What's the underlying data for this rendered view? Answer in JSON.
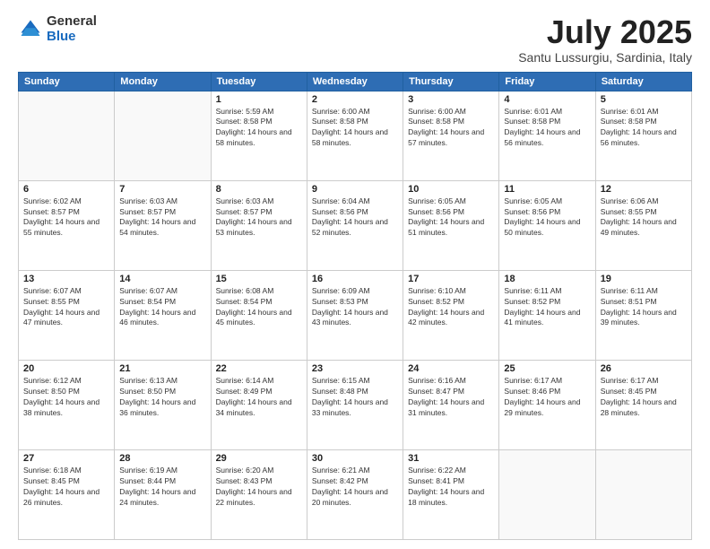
{
  "header": {
    "logo_general": "General",
    "logo_blue": "Blue",
    "title": "July 2025",
    "location": "Santu Lussurgiu, Sardinia, Italy"
  },
  "weekdays": [
    "Sunday",
    "Monday",
    "Tuesday",
    "Wednesday",
    "Thursday",
    "Friday",
    "Saturday"
  ],
  "weeks": [
    [
      {
        "day": "",
        "sunrise": "",
        "sunset": "",
        "daylight": ""
      },
      {
        "day": "",
        "sunrise": "",
        "sunset": "",
        "daylight": ""
      },
      {
        "day": "1",
        "sunrise": "Sunrise: 5:59 AM",
        "sunset": "Sunset: 8:58 PM",
        "daylight": "Daylight: 14 hours and 58 minutes."
      },
      {
        "day": "2",
        "sunrise": "Sunrise: 6:00 AM",
        "sunset": "Sunset: 8:58 PM",
        "daylight": "Daylight: 14 hours and 58 minutes."
      },
      {
        "day": "3",
        "sunrise": "Sunrise: 6:00 AM",
        "sunset": "Sunset: 8:58 PM",
        "daylight": "Daylight: 14 hours and 57 minutes."
      },
      {
        "day": "4",
        "sunrise": "Sunrise: 6:01 AM",
        "sunset": "Sunset: 8:58 PM",
        "daylight": "Daylight: 14 hours and 56 minutes."
      },
      {
        "day": "5",
        "sunrise": "Sunrise: 6:01 AM",
        "sunset": "Sunset: 8:58 PM",
        "daylight": "Daylight: 14 hours and 56 minutes."
      }
    ],
    [
      {
        "day": "6",
        "sunrise": "Sunrise: 6:02 AM",
        "sunset": "Sunset: 8:57 PM",
        "daylight": "Daylight: 14 hours and 55 minutes."
      },
      {
        "day": "7",
        "sunrise": "Sunrise: 6:03 AM",
        "sunset": "Sunset: 8:57 PM",
        "daylight": "Daylight: 14 hours and 54 minutes."
      },
      {
        "day": "8",
        "sunrise": "Sunrise: 6:03 AM",
        "sunset": "Sunset: 8:57 PM",
        "daylight": "Daylight: 14 hours and 53 minutes."
      },
      {
        "day": "9",
        "sunrise": "Sunrise: 6:04 AM",
        "sunset": "Sunset: 8:56 PM",
        "daylight": "Daylight: 14 hours and 52 minutes."
      },
      {
        "day": "10",
        "sunrise": "Sunrise: 6:05 AM",
        "sunset": "Sunset: 8:56 PM",
        "daylight": "Daylight: 14 hours and 51 minutes."
      },
      {
        "day": "11",
        "sunrise": "Sunrise: 6:05 AM",
        "sunset": "Sunset: 8:56 PM",
        "daylight": "Daylight: 14 hours and 50 minutes."
      },
      {
        "day": "12",
        "sunrise": "Sunrise: 6:06 AM",
        "sunset": "Sunset: 8:55 PM",
        "daylight": "Daylight: 14 hours and 49 minutes."
      }
    ],
    [
      {
        "day": "13",
        "sunrise": "Sunrise: 6:07 AM",
        "sunset": "Sunset: 8:55 PM",
        "daylight": "Daylight: 14 hours and 47 minutes."
      },
      {
        "day": "14",
        "sunrise": "Sunrise: 6:07 AM",
        "sunset": "Sunset: 8:54 PM",
        "daylight": "Daylight: 14 hours and 46 minutes."
      },
      {
        "day": "15",
        "sunrise": "Sunrise: 6:08 AM",
        "sunset": "Sunset: 8:54 PM",
        "daylight": "Daylight: 14 hours and 45 minutes."
      },
      {
        "day": "16",
        "sunrise": "Sunrise: 6:09 AM",
        "sunset": "Sunset: 8:53 PM",
        "daylight": "Daylight: 14 hours and 43 minutes."
      },
      {
        "day": "17",
        "sunrise": "Sunrise: 6:10 AM",
        "sunset": "Sunset: 8:52 PM",
        "daylight": "Daylight: 14 hours and 42 minutes."
      },
      {
        "day": "18",
        "sunrise": "Sunrise: 6:11 AM",
        "sunset": "Sunset: 8:52 PM",
        "daylight": "Daylight: 14 hours and 41 minutes."
      },
      {
        "day": "19",
        "sunrise": "Sunrise: 6:11 AM",
        "sunset": "Sunset: 8:51 PM",
        "daylight": "Daylight: 14 hours and 39 minutes."
      }
    ],
    [
      {
        "day": "20",
        "sunrise": "Sunrise: 6:12 AM",
        "sunset": "Sunset: 8:50 PM",
        "daylight": "Daylight: 14 hours and 38 minutes."
      },
      {
        "day": "21",
        "sunrise": "Sunrise: 6:13 AM",
        "sunset": "Sunset: 8:50 PM",
        "daylight": "Daylight: 14 hours and 36 minutes."
      },
      {
        "day": "22",
        "sunrise": "Sunrise: 6:14 AM",
        "sunset": "Sunset: 8:49 PM",
        "daylight": "Daylight: 14 hours and 34 minutes."
      },
      {
        "day": "23",
        "sunrise": "Sunrise: 6:15 AM",
        "sunset": "Sunset: 8:48 PM",
        "daylight": "Daylight: 14 hours and 33 minutes."
      },
      {
        "day": "24",
        "sunrise": "Sunrise: 6:16 AM",
        "sunset": "Sunset: 8:47 PM",
        "daylight": "Daylight: 14 hours and 31 minutes."
      },
      {
        "day": "25",
        "sunrise": "Sunrise: 6:17 AM",
        "sunset": "Sunset: 8:46 PM",
        "daylight": "Daylight: 14 hours and 29 minutes."
      },
      {
        "day": "26",
        "sunrise": "Sunrise: 6:17 AM",
        "sunset": "Sunset: 8:45 PM",
        "daylight": "Daylight: 14 hours and 28 minutes."
      }
    ],
    [
      {
        "day": "27",
        "sunrise": "Sunrise: 6:18 AM",
        "sunset": "Sunset: 8:45 PM",
        "daylight": "Daylight: 14 hours and 26 minutes."
      },
      {
        "day": "28",
        "sunrise": "Sunrise: 6:19 AM",
        "sunset": "Sunset: 8:44 PM",
        "daylight": "Daylight: 14 hours and 24 minutes."
      },
      {
        "day": "29",
        "sunrise": "Sunrise: 6:20 AM",
        "sunset": "Sunset: 8:43 PM",
        "daylight": "Daylight: 14 hours and 22 minutes."
      },
      {
        "day": "30",
        "sunrise": "Sunrise: 6:21 AM",
        "sunset": "Sunset: 8:42 PM",
        "daylight": "Daylight: 14 hours and 20 minutes."
      },
      {
        "day": "31",
        "sunrise": "Sunrise: 6:22 AM",
        "sunset": "Sunset: 8:41 PM",
        "daylight": "Daylight: 14 hours and 18 minutes."
      },
      {
        "day": "",
        "sunrise": "",
        "sunset": "",
        "daylight": ""
      },
      {
        "day": "",
        "sunrise": "",
        "sunset": "",
        "daylight": ""
      }
    ]
  ]
}
